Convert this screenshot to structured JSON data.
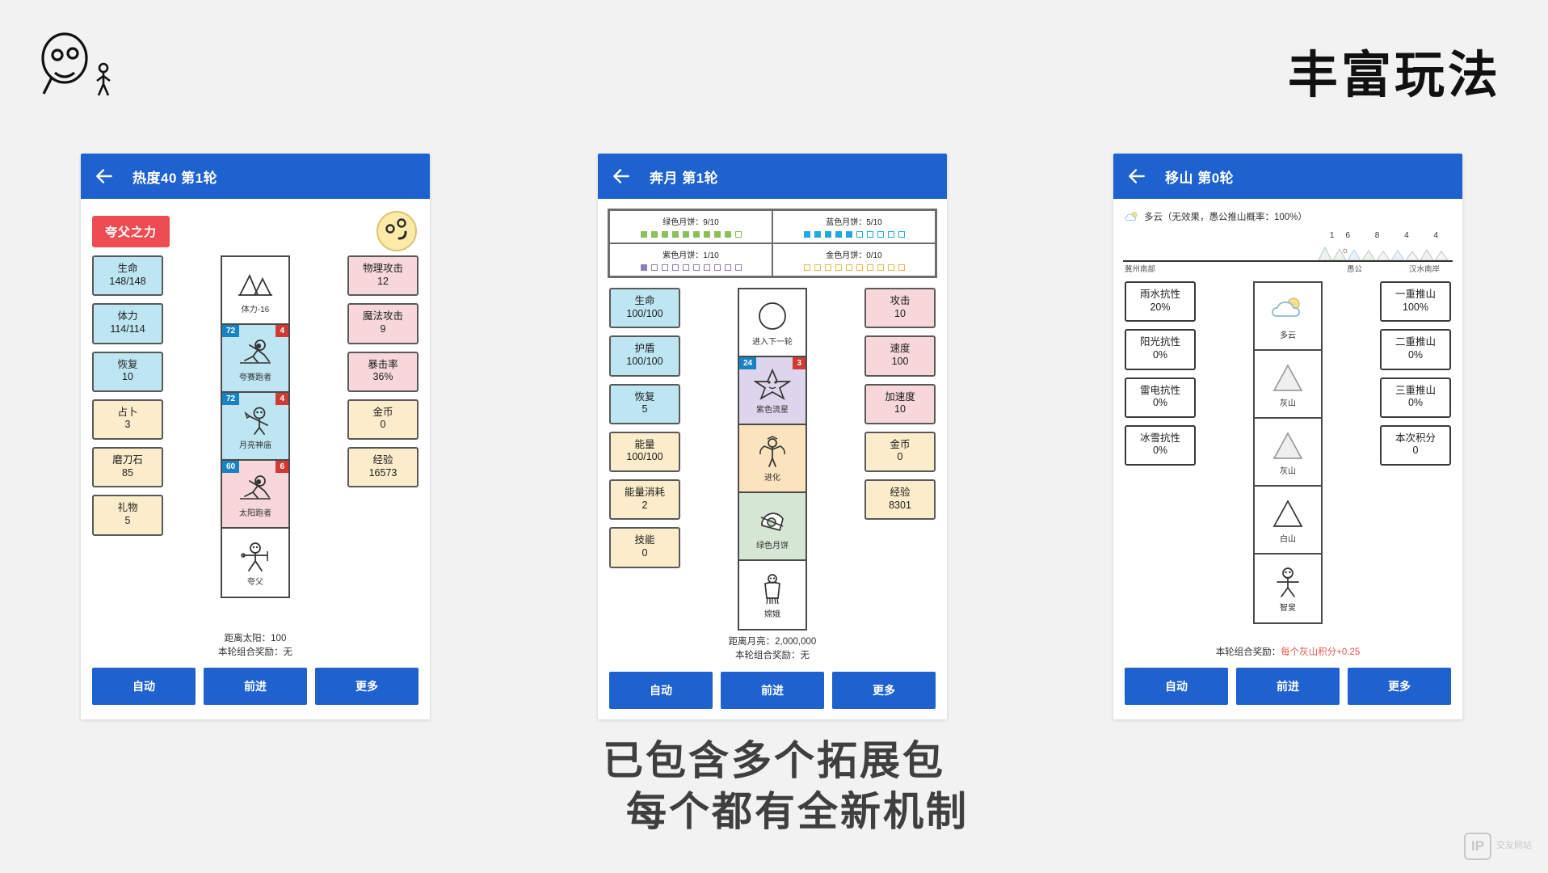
{
  "hero": {
    "title": "丰富玩法",
    "logo_icon": "stickman-ghost-logo"
  },
  "caption": {
    "line1": "已包含多个拓展包",
    "line2": "每个都有全新机制"
  },
  "watermark": {
    "mark": "IP",
    "text": "交友网站"
  },
  "buttons": {
    "auto": "自动",
    "advance": "前进",
    "more": "更多"
  },
  "panel1": {
    "title": "热度40 第1轮",
    "back_icon": "arrow-left-icon",
    "skill_chip": "夸父之力",
    "avatar_icon": "sun-face-icon",
    "left_stats": [
      {
        "name": "生命",
        "value": "148/148",
        "color": "blue"
      },
      {
        "name": "体力",
        "value": "114/114",
        "color": "blue"
      },
      {
        "name": "恢复",
        "value": "10",
        "color": "blue"
      },
      {
        "name": "占卜",
        "value": "3",
        "color": "cream"
      },
      {
        "name": "磨刀石",
        "value": "85",
        "color": "cream"
      },
      {
        "name": "礼物",
        "value": "5",
        "color": "cream"
      }
    ],
    "right_stats": [
      {
        "name": "物理攻击",
        "value": "12",
        "color": "pink"
      },
      {
        "name": "魔法攻击",
        "value": "9",
        "color": "pink"
      },
      {
        "name": "暴击率",
        "value": "36%",
        "color": "pink"
      },
      {
        "name": "金币",
        "value": "0",
        "color": "cream"
      },
      {
        "name": "经验",
        "value": "16573",
        "color": "cream"
      }
    ],
    "cards": [
      {
        "caption": "体力-16",
        "color": "white",
        "icon": "mountain-icon",
        "left_badge": null,
        "right_badge": null
      },
      {
        "caption": "夸赛跑者",
        "color": "blue",
        "icon": "runner-icon",
        "left_badge": "72",
        "right_badge": "4"
      },
      {
        "caption": "月亮神庙",
        "color": "blue",
        "icon": "temple-figure-icon",
        "left_badge": "72",
        "right_badge": "4"
      },
      {
        "caption": "太阳跑者",
        "color": "pink",
        "icon": "runner-icon",
        "left_badge": "60",
        "right_badge": "6"
      },
      {
        "caption": "夸父",
        "color": "white",
        "icon": "kuafu-icon",
        "left_badge": null,
        "right_badge": null
      }
    ],
    "footnotes": {
      "distance": "距离太阳：100",
      "bonus": "本轮组合奖励：无"
    }
  },
  "panel2": {
    "title": "奔月 第1轮",
    "back_icon": "arrow-left-icon",
    "mooncakes": [
      {
        "label": "绿色月饼：9/10",
        "filled": 9,
        "total": 10,
        "color": "#8bbf5a"
      },
      {
        "label": "蓝色月饼：5/10",
        "filled": 5,
        "total": 10,
        "color": "#23a7e0"
      },
      {
        "label": "紫色月饼：1/10",
        "filled": 1,
        "total": 10,
        "color": "#8f7fb8"
      },
      {
        "label": "金色月饼：0/10",
        "filled": 0,
        "total": 10,
        "color": "#e8b84b"
      }
    ],
    "left_stats": [
      {
        "name": "生命",
        "value": "100/100",
        "color": "blue"
      },
      {
        "name": "护盾",
        "value": "100/100",
        "color": "blue"
      },
      {
        "name": "恢复",
        "value": "5",
        "color": "blue"
      },
      {
        "name": "能量",
        "value": "100/100",
        "color": "cream"
      },
      {
        "name": "能量消耗",
        "value": "2",
        "color": "cream"
      },
      {
        "name": "技能",
        "value": "0",
        "color": "cream"
      }
    ],
    "right_stats": [
      {
        "name": "攻击",
        "value": "10",
        "color": "pink"
      },
      {
        "name": "速度",
        "value": "100",
        "color": "pink"
      },
      {
        "name": "加速度",
        "value": "10",
        "color": "pink"
      },
      {
        "name": "金币",
        "value": "0",
        "color": "cream"
      },
      {
        "name": "经验",
        "value": "8301",
        "color": "cream"
      }
    ],
    "cards": [
      {
        "caption": "进入下一轮",
        "color": "white",
        "icon": "circle-icon",
        "left_badge": null,
        "right_badge": null
      },
      {
        "caption": "紫色流星",
        "color": "purple",
        "icon": "star-face-icon",
        "left_badge": "24",
        "right_badge": "3"
      },
      {
        "caption": "进化",
        "color": "cream",
        "icon": "evolve-figure-icon",
        "left_badge": null,
        "right_badge": null
      },
      {
        "caption": "绿色月饼",
        "color": "green",
        "icon": "mooncake-icon",
        "left_badge": null,
        "right_badge": null
      },
      {
        "caption": "嫦娥",
        "color": "white",
        "icon": "change-figure-icon",
        "left_badge": null,
        "right_badge": null
      }
    ],
    "footnotes": {
      "distance": "距离月亮：2,000,000",
      "bonus": "本轮组合奖励：无"
    }
  },
  "panel3": {
    "title": "移山 第0轮",
    "back_icon": "arrow-left-icon",
    "weather_icon": "cloudy-icon",
    "weather_text": "多云（无效果，愚公推山概率：100%）",
    "terrain": {
      "numbers": "16 8 4 4",
      "left_label": "冀州南部",
      "right_label_1": "愚公",
      "right_label_2": "汉水南岸"
    },
    "left_stats": [
      {
        "name": "雨水抗性",
        "value": "20%",
        "color": "plain"
      },
      {
        "name": "阳光抗性",
        "value": "0%",
        "color": "plain"
      },
      {
        "name": "雷电抗性",
        "value": "0%",
        "color": "plain"
      },
      {
        "name": "冰雪抗性",
        "value": "0%",
        "color": "plain"
      }
    ],
    "right_stats": [
      {
        "name": "一重推山",
        "value": "100%",
        "color": "plain"
      },
      {
        "name": "二重推山",
        "value": "0%",
        "color": "plain"
      },
      {
        "name": "三重推山",
        "value": "0%",
        "color": "plain"
      },
      {
        "name": "本次积分",
        "value": "0",
        "color": "plain"
      }
    ],
    "cards": [
      {
        "caption": "多云",
        "color": "white",
        "icon": "cloudy-icon",
        "left_badge": null,
        "right_badge": null
      },
      {
        "caption": "灰山",
        "color": "white",
        "icon": "gray-mountain-icon",
        "left_badge": null,
        "right_badge": null
      },
      {
        "caption": "灰山",
        "color": "white",
        "icon": "gray-mountain-icon",
        "left_badge": null,
        "right_badge": null
      },
      {
        "caption": "白山",
        "color": "white",
        "icon": "white-mountain-icon",
        "left_badge": null,
        "right_badge": null
      },
      {
        "caption": "智叟",
        "color": "white",
        "icon": "zhisou-figure-icon",
        "left_badge": null,
        "right_badge": null
      }
    ],
    "footnotes": {
      "bonus_label": "本轮组合奖励：",
      "bonus_value": "每个灰山积分+0.25"
    }
  }
}
